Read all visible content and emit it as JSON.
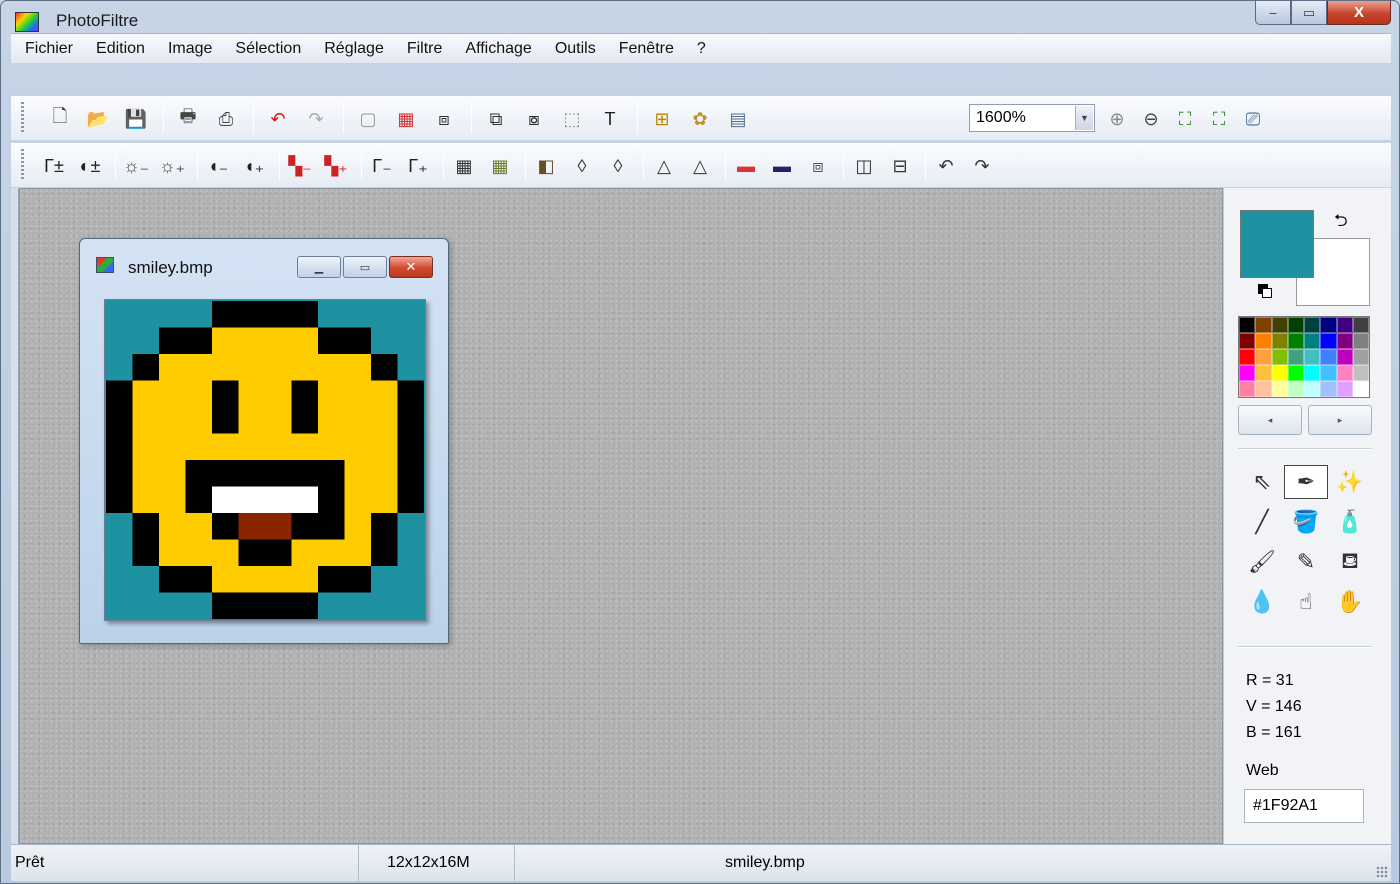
{
  "app": {
    "title": "PhotoFiltre"
  },
  "window_controls": {
    "minimize": "–",
    "maximize": "▭",
    "close": "X"
  },
  "menu": [
    "Fichier",
    "Edition",
    "Image",
    "Sélection",
    "Réglage",
    "Filtre",
    "Affichage",
    "Outils",
    "Fenêtre",
    "?"
  ],
  "toolbar1": {
    "buttons": [
      {
        "name": "new-icon",
        "glyph": "🗋",
        "color": "#333"
      },
      {
        "name": "open-icon",
        "glyph": "📂",
        "color": "#b8860b"
      },
      {
        "name": "save-icon",
        "glyph": "💾",
        "color": "#2a3b6b"
      },
      {
        "sep": true
      },
      {
        "name": "print-icon",
        "glyph": "🖶",
        "color": "#444"
      },
      {
        "name": "scan-icon",
        "glyph": "⎙",
        "color": "#444"
      },
      {
        "sep": true
      },
      {
        "name": "undo-icon",
        "glyph": "↶",
        "color": "#d11"
      },
      {
        "name": "redo-icon",
        "glyph": "↷",
        "color": "#aaa"
      },
      {
        "sep": true
      },
      {
        "name": "paste-new-icon",
        "glyph": "▢",
        "color": "#999"
      },
      {
        "name": "color-grid-icon",
        "glyph": "▦",
        "color": "#c33"
      },
      {
        "name": "image-resize-icon",
        "glyph": "⧈",
        "color": "#333"
      },
      {
        "sep": true
      },
      {
        "name": "canvas-size-icon",
        "glyph": "⧉",
        "color": "#333"
      },
      {
        "name": "crop-icon",
        "glyph": "⧇",
        "color": "#333"
      },
      {
        "name": "selection-icon",
        "glyph": "⬚",
        "color": "#888"
      },
      {
        "name": "text-icon",
        "glyph": "T",
        "color": "#222"
      },
      {
        "sep": true
      },
      {
        "name": "explorer-icon",
        "glyph": "⊞",
        "color": "#b88a00"
      },
      {
        "name": "plugin-icon",
        "glyph": "✿",
        "color": "#c69030"
      },
      {
        "name": "window-icon",
        "glyph": "▤",
        "color": "#55708f"
      }
    ],
    "zoom_value": "1600%",
    "zoom_buttons": [
      {
        "name": "zoom-in-icon",
        "glyph": "⊕",
        "color": "#888"
      },
      {
        "name": "zoom-out-icon",
        "glyph": "⊖",
        "color": "#444"
      },
      {
        "name": "fit-screen-icon",
        "glyph": "⛶",
        "color": "#3a8a2a"
      },
      {
        "name": "actual-size-icon",
        "glyph": "⛶",
        "color": "#3a8a2a"
      },
      {
        "name": "fullscreen-icon",
        "glyph": "⎚",
        "color": "#2a5a8a"
      }
    ]
  },
  "toolbar2": {
    "buttons": [
      {
        "name": "auto-levels-icon",
        "glyph": "Γ±",
        "color": "#222"
      },
      {
        "name": "auto-contrast-icon",
        "glyph": "◐±",
        "color": "#222"
      },
      {
        "sep": true
      },
      {
        "name": "brightness-minus-icon",
        "glyph": "☼₋",
        "color": "#444"
      },
      {
        "name": "brightness-plus-icon",
        "glyph": "☼₊",
        "color": "#444"
      },
      {
        "sep": true
      },
      {
        "name": "contrast-minus-icon",
        "glyph": "◖₋",
        "color": "#222"
      },
      {
        "name": "contrast-plus-icon",
        "glyph": "◖₊",
        "color": "#222"
      },
      {
        "sep": true
      },
      {
        "name": "saturation-minus-icon",
        "glyph": "▚₋",
        "color": "#c22"
      },
      {
        "name": "saturation-plus-icon",
        "glyph": "▚₊",
        "color": "#c22"
      },
      {
        "sep": true
      },
      {
        "name": "gamma-minus-icon",
        "glyph": "Γ₋",
        "color": "#222"
      },
      {
        "name": "gamma-plus-icon",
        "glyph": "Γ₊",
        "color": "#222"
      },
      {
        "sep": true
      },
      {
        "name": "grayscale-icon",
        "glyph": "▦",
        "color": "#333"
      },
      {
        "name": "sepia-icon",
        "glyph": "▦",
        "color": "#6b7a2a"
      },
      {
        "sep": true
      },
      {
        "name": "flip-icon",
        "glyph": "◧",
        "color": "#6b4a2a"
      },
      {
        "name": "blur-icon",
        "glyph": "◊",
        "color": "#333"
      },
      {
        "name": "sharpen-icon",
        "glyph": "◊",
        "color": "#333"
      },
      {
        "sep": true
      },
      {
        "name": "soften-icon",
        "glyph": "△",
        "color": "#333"
      },
      {
        "name": "emboss-icon",
        "glyph": "△",
        "color": "#333"
      },
      {
        "sep": true
      },
      {
        "name": "gradient-icon",
        "glyph": "▬",
        "color": "#d33"
      },
      {
        "name": "fade-icon",
        "glyph": "▬",
        "color": "#226"
      },
      {
        "name": "texture-icon",
        "glyph": "⧈",
        "color": "#556"
      },
      {
        "sep": true
      },
      {
        "name": "mirror-icon",
        "glyph": "◫",
        "color": "#333"
      },
      {
        "name": "flip-vertical-icon",
        "glyph": "⊟",
        "color": "#333"
      },
      {
        "sep": true
      },
      {
        "name": "rotate-left-icon",
        "glyph": "↶",
        "color": "#333"
      },
      {
        "name": "rotate-right-icon",
        "glyph": "↷",
        "color": "#333"
      }
    ]
  },
  "document": {
    "title": "smiley.bmp",
    "pixel_rows": [
      "TTTTKKKKTTTT",
      "TTKKYYYYKKTT",
      "TKYYYYYYYYKT",
      "KYYYKYYKYYYK",
      "KYYYKYYKYYYK",
      "KYYYYYYYYYYK",
      "KYYKKKKKKYYK",
      "KYYKWWWWKYYK",
      "TKYYKBBKKYKT",
      "TKYYYKKYYYKT",
      "TTKKYYYYKKTT",
      "TTTTKKKKTTTT"
    ],
    "pixel_colors": {
      "T": "#1f92a1",
      "K": "#000000",
      "Y": "#ffcc00",
      "W": "#ffffff",
      "B": "#8b2500"
    }
  },
  "colors": {
    "foreground": "#1f92a1",
    "background": "#ffffff",
    "palette": [
      "#000000",
      "#804000",
      "#404000",
      "#004000",
      "#004040",
      "#000080",
      "#400080",
      "#404040",
      "#800000",
      "#ff8000",
      "#808000",
      "#008000",
      "#008080",
      "#0000ff",
      "#800080",
      "#808080",
      "#ff0000",
      "#ffa040",
      "#80c000",
      "#40a080",
      "#40c0c0",
      "#4080ff",
      "#c000c0",
      "#a0a0a0",
      "#ff00ff",
      "#ffc040",
      "#ffff00",
      "#00ff00",
      "#00ffff",
      "#40c0ff",
      "#ff80c0",
      "#c0c0c0",
      "#ff80a0",
      "#ffc0a0",
      "#ffffa0",
      "#c0ffc0",
      "#c0ffff",
      "#a0c0ff",
      "#e0a0ff",
      "#ffffff"
    ]
  },
  "palette_nav": {
    "prev": "◂",
    "next": "▸"
  },
  "tools": [
    {
      "name": "pointer-tool-icon",
      "glyph": "⇖"
    },
    {
      "name": "eyedropper-tool-icon",
      "glyph": "✒"
    },
    {
      "name": "magic-wand-tool-icon",
      "glyph": "✨"
    },
    {
      "name": "line-tool-icon",
      "glyph": "╱"
    },
    {
      "name": "fill-tool-icon",
      "glyph": "🪣"
    },
    {
      "name": "spray-tool-icon",
      "glyph": "🧴"
    },
    {
      "name": "brush-tool-icon",
      "glyph": "🖌"
    },
    {
      "name": "advanced-brush-tool-icon",
      "glyph": "✎"
    },
    {
      "name": "stamp-tool-icon",
      "glyph": "⛾"
    },
    {
      "name": "blur-tool-icon",
      "glyph": "💧"
    },
    {
      "name": "smudge-tool-icon",
      "glyph": "☝"
    },
    {
      "name": "hand-tool-icon",
      "glyph": "✋"
    }
  ],
  "active_tool_index": 1,
  "color_values": {
    "r": "R = 31",
    "v": "V = 146",
    "b": "B = 161"
  },
  "web_label": "Web",
  "web_value": "#1F92A1",
  "status": {
    "ready": "Prêt",
    "dimensions": "12x12x16M",
    "filename": "smiley.bmp"
  }
}
